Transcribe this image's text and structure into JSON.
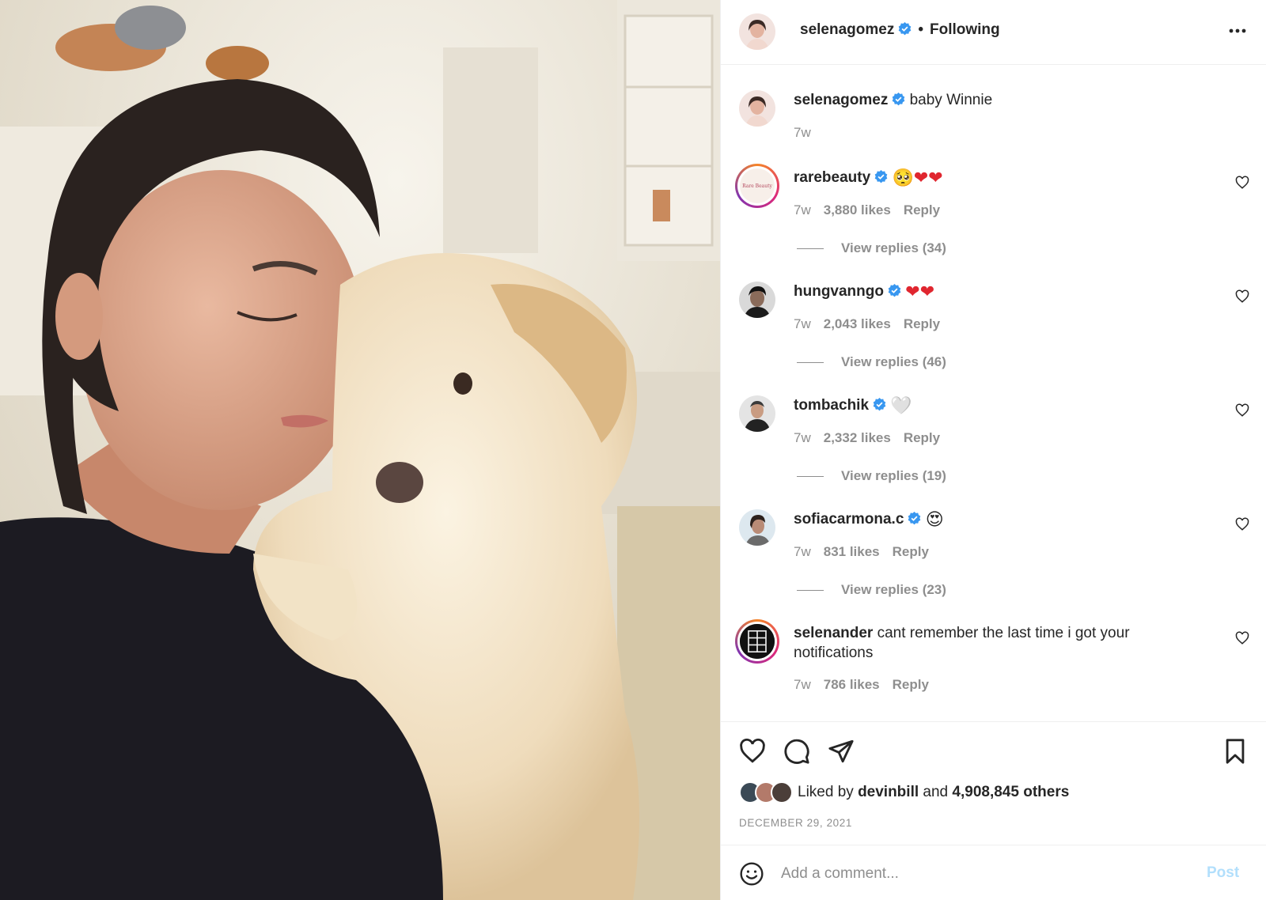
{
  "colors": {
    "verified_blue": "#3897f0",
    "text_primary": "#262626",
    "text_secondary": "#8e8e8e",
    "post_button_disabled": "#b2dffc",
    "divider": "#efefef"
  },
  "header": {
    "username": "selenagomez",
    "verified": true,
    "separator": "•",
    "follow_state": "Following",
    "more_icon": "more-horizontal-icon"
  },
  "caption": {
    "username": "selenagomez",
    "text": "baby Winnie",
    "time": "7w"
  },
  "comments": [
    {
      "username": "rarebeauty",
      "verified": true,
      "avatar_text": "Rare Beauty",
      "emoji": [
        "🥺",
        "❤",
        "❤"
      ],
      "time": "7w",
      "likes": "3,880 likes",
      "reply_label": "Reply",
      "view_replies": "View replies (34)"
    },
    {
      "username": "hungvanngo",
      "verified": true,
      "emoji": [
        "❤",
        "❤"
      ],
      "time": "7w",
      "likes": "2,043 likes",
      "reply_label": "Reply",
      "view_replies": "View replies (46)"
    },
    {
      "username": "tombachik",
      "verified": true,
      "emoji": [
        "🤍"
      ],
      "time": "7w",
      "likes": "2,332 likes",
      "reply_label": "Reply",
      "view_replies": "View replies (19)"
    },
    {
      "username": "sofiacarmona.c",
      "verified": true,
      "emoji": [
        "😍"
      ],
      "time": "7w",
      "likes": "831 likes",
      "reply_label": "Reply",
      "view_replies": "View replies (23)"
    },
    {
      "username": "selenander",
      "verified": false,
      "text": "cant remember the last time i got your notifications",
      "time": "7w",
      "likes": "786 likes",
      "reply_label": "Reply"
    }
  ],
  "actions": {
    "icons": [
      "heart-icon",
      "comment-icon",
      "share-icon",
      "bookmark-icon"
    ],
    "liked_by_prefix": "Liked by",
    "liked_by_user": "devinbill",
    "liked_by_and": "and",
    "liked_by_others": "4,908,845 others",
    "date": "DECEMBER 29, 2021"
  },
  "add_comment": {
    "placeholder": "Add a comment...",
    "post_label": "Post",
    "emoji_icon": "smiley-icon"
  }
}
